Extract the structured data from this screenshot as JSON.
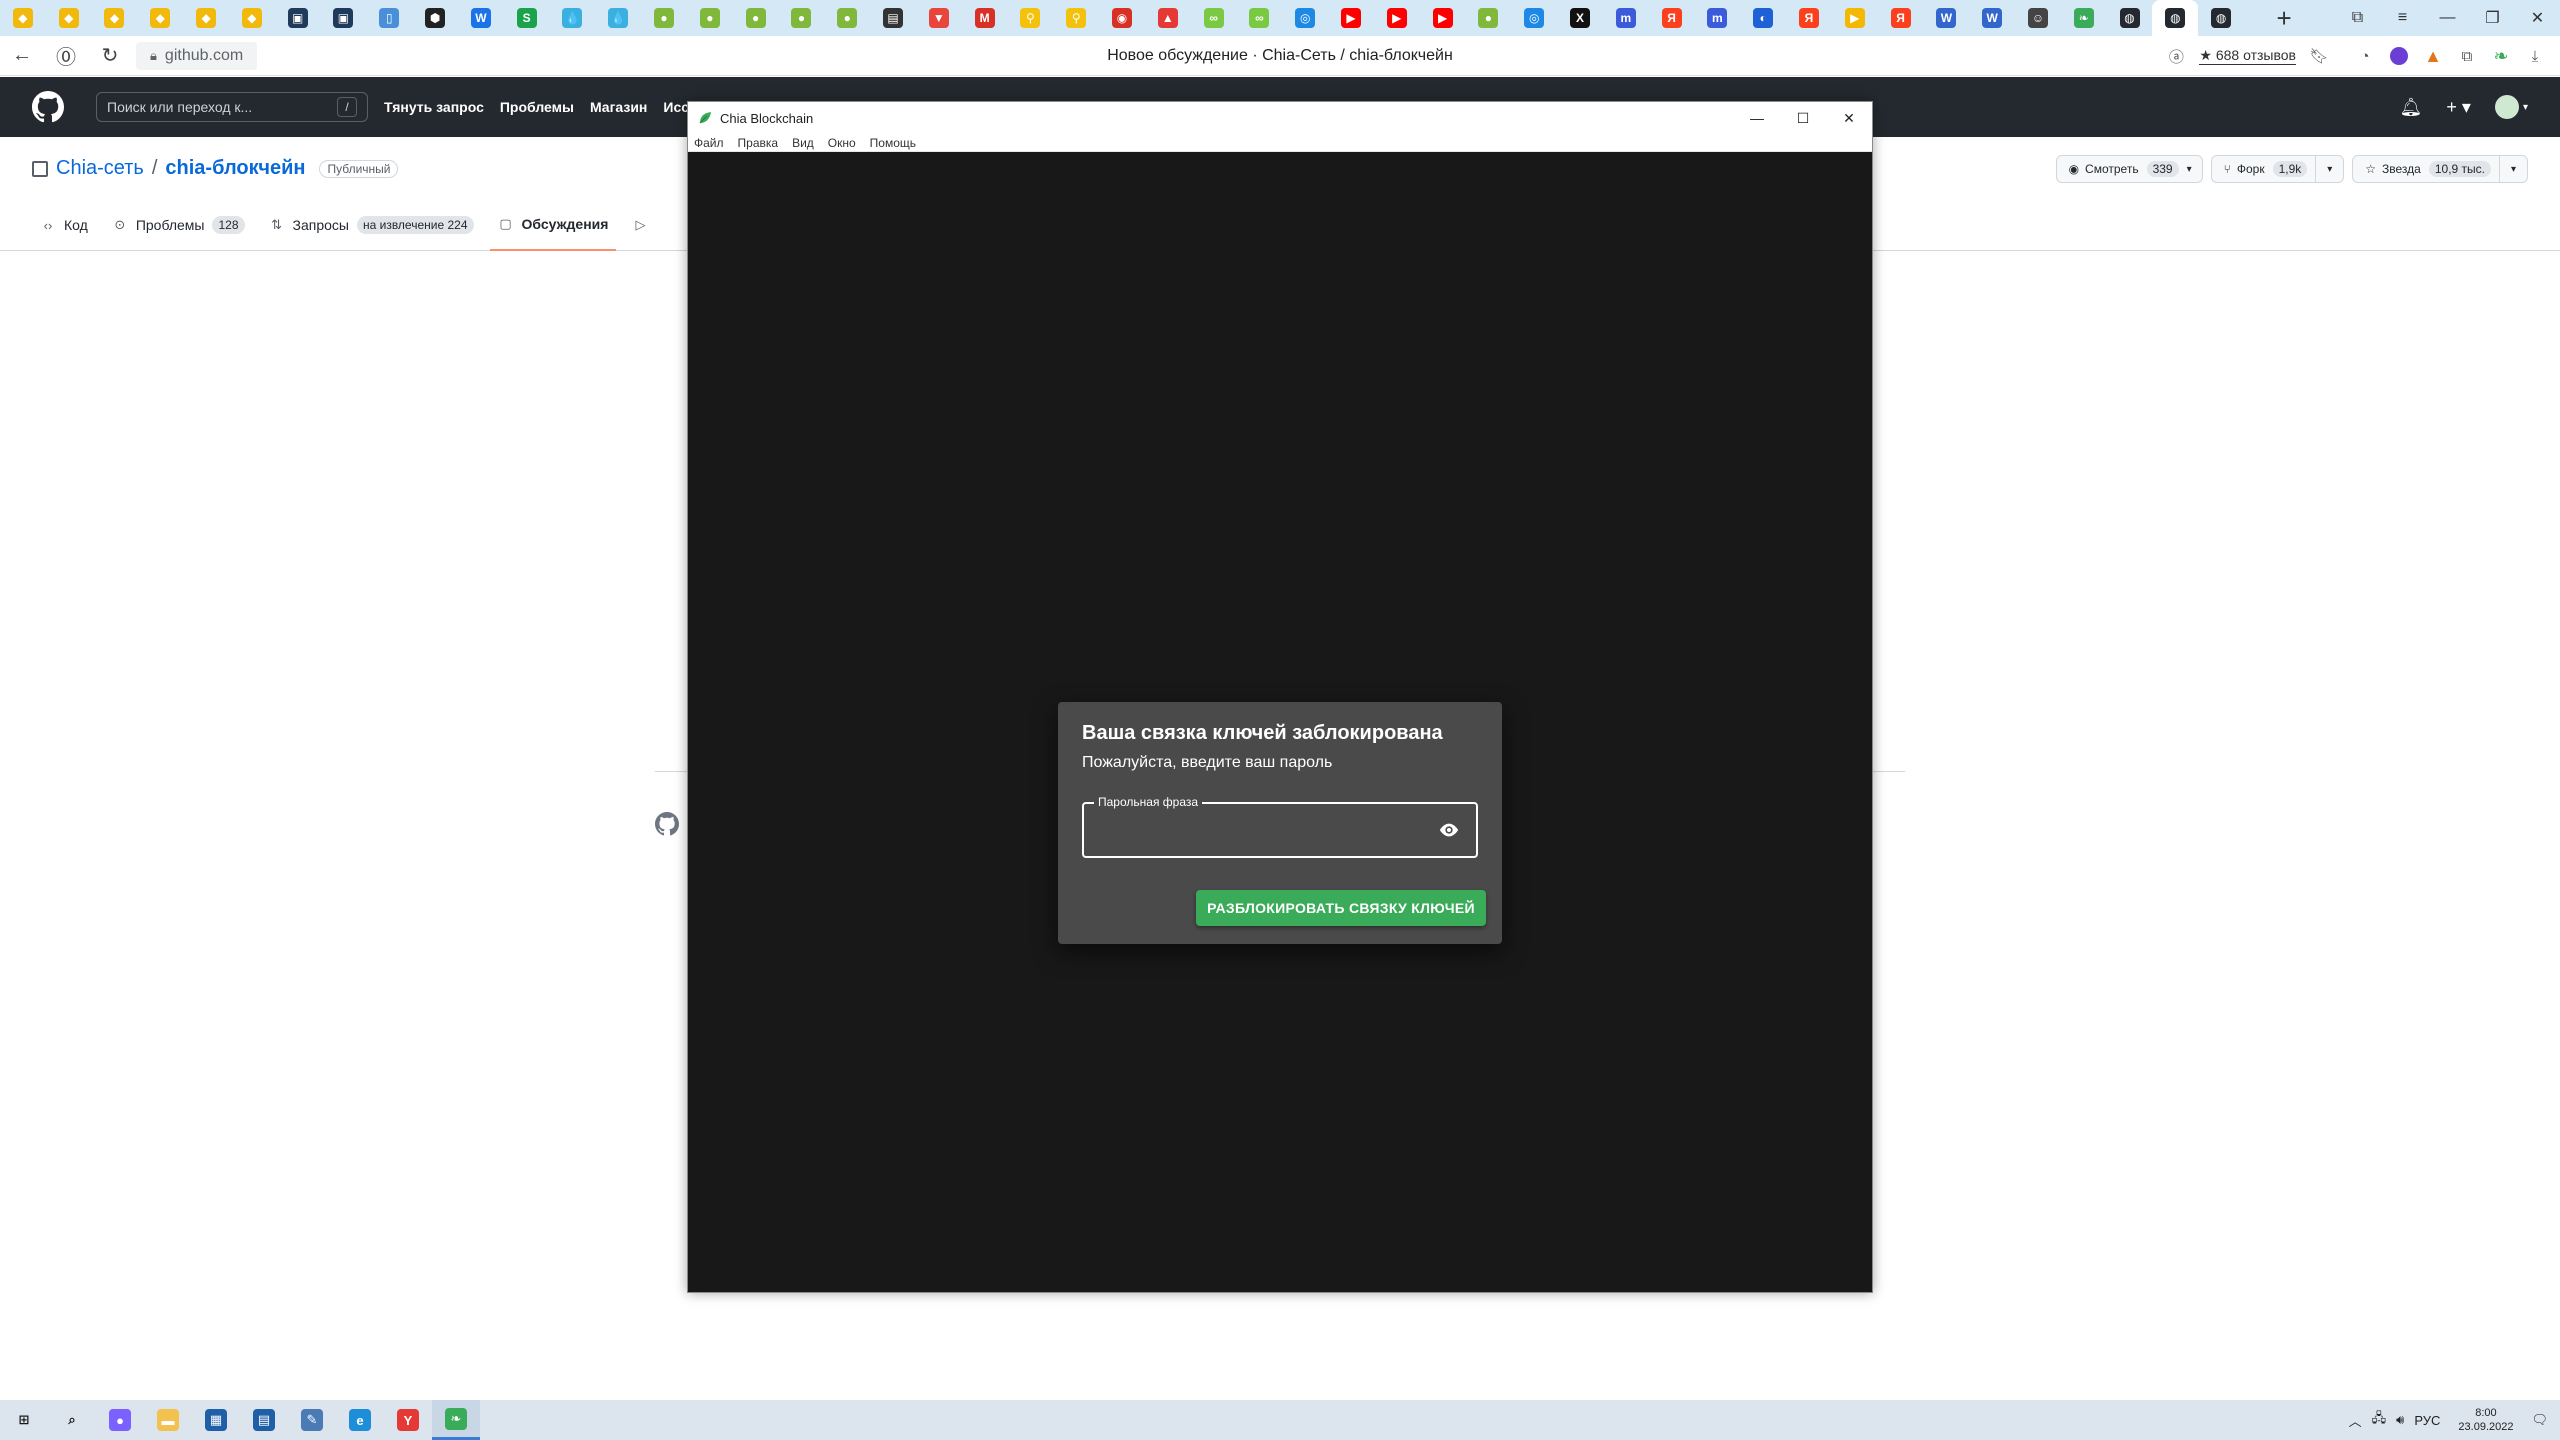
{
  "browser": {
    "tabs": [
      {
        "icon": "binance-icon",
        "color": "#f0b90b",
        "glyph": "◆"
      },
      {
        "icon": "binance-icon",
        "color": "#f0b90b",
        "glyph": "◆"
      },
      {
        "icon": "binance-icon",
        "color": "#f0b90b",
        "glyph": "◆"
      },
      {
        "icon": "binance-icon",
        "color": "#f0b90b",
        "glyph": "◆"
      },
      {
        "icon": "binance-icon",
        "color": "#f0b90b",
        "glyph": "◆"
      },
      {
        "icon": "binance-icon",
        "color": "#f0b90b",
        "glyph": "◆"
      },
      {
        "icon": "app-icon",
        "color": "#1f3a5a",
        "glyph": "▣"
      },
      {
        "icon": "app-icon",
        "color": "#1f3a5a",
        "glyph": "▣"
      },
      {
        "icon": "document-icon",
        "color": "#4a90d9",
        "glyph": "▯"
      },
      {
        "icon": "hive-icon",
        "color": "#222222",
        "glyph": "⬢"
      },
      {
        "icon": "w-icon",
        "color": "#1a73e8",
        "glyph": "W"
      },
      {
        "icon": "s-icon",
        "color": "#1aa34a",
        "glyph": "S"
      },
      {
        "icon": "drop-icon",
        "color": "#3ab0e0",
        "glyph": "💧"
      },
      {
        "icon": "drop-icon",
        "color": "#3ab0e0",
        "glyph": "💧"
      },
      {
        "icon": "chia-icon",
        "color": "#7fb83b",
        "glyph": "●"
      },
      {
        "icon": "chia-icon",
        "color": "#7fb83b",
        "glyph": "●"
      },
      {
        "icon": "chia-icon",
        "color": "#7fb83b",
        "glyph": "●"
      },
      {
        "icon": "chia-icon",
        "color": "#7fb83b",
        "glyph": "●"
      },
      {
        "icon": "chia-icon",
        "color": "#7fb83b",
        "glyph": "●"
      },
      {
        "icon": "chart-icon",
        "color": "#333333",
        "glyph": "▤"
      },
      {
        "icon": "flag-icon",
        "color": "#e8453c",
        "glyph": "▼"
      },
      {
        "icon": "gmail-icon",
        "color": "#d93025",
        "glyph": "M"
      },
      {
        "icon": "search-coin-icon",
        "color": "#f4c20d",
        "glyph": "⚲"
      },
      {
        "icon": "search-coin-icon",
        "color": "#f4c20d",
        "glyph": "⚲"
      },
      {
        "icon": "record-icon",
        "color": "#d93025",
        "glyph": "◉"
      },
      {
        "icon": "mushroom-icon",
        "color": "#e53935",
        "glyph": "▲"
      },
      {
        "icon": "link-icon",
        "color": "#7ac943",
        "glyph": "∞"
      },
      {
        "icon": "link-icon",
        "color": "#7ac943",
        "glyph": "∞"
      },
      {
        "icon": "browser-icon",
        "color": "#1e88e5",
        "glyph": "◎"
      },
      {
        "icon": "youtube-icon",
        "color": "#ff0000",
        "glyph": "▶"
      },
      {
        "icon": "youtube-icon",
        "color": "#ff0000",
        "glyph": "▶"
      },
      {
        "icon": "youtube-icon",
        "color": "#ff0000",
        "glyph": "▶"
      },
      {
        "icon": "chia-icon",
        "color": "#7fb83b",
        "glyph": "●"
      },
      {
        "icon": "browser-icon",
        "color": "#1e88e5",
        "glyph": "◎"
      },
      {
        "icon": "x-icon",
        "color": "#111111",
        "glyph": "X"
      },
      {
        "icon": "m-icon",
        "color": "#3b5bdb",
        "glyph": "m"
      },
      {
        "icon": "yandex-icon",
        "color": "#fc3f1d",
        "glyph": "Я"
      },
      {
        "icon": "m-icon",
        "color": "#3b5bdb",
        "glyph": "m"
      },
      {
        "icon": "chat-icon",
        "color": "#1e60d5",
        "glyph": "◐"
      },
      {
        "icon": "yandex-icon",
        "color": "#fc3f1d",
        "glyph": "Я"
      },
      {
        "icon": "play-icon",
        "color": "#f5b800",
        "glyph": "▶"
      },
      {
        "icon": "yandex-icon",
        "color": "#fc3f1d",
        "glyph": "Я"
      },
      {
        "icon": "wiki-icon",
        "color": "#3366cc",
        "glyph": "W"
      },
      {
        "icon": "wiki-icon",
        "color": "#3366cc",
        "glyph": "W"
      },
      {
        "icon": "emoji-icon",
        "color": "#444444",
        "glyph": "☺"
      },
      {
        "icon": "leaf-icon",
        "color": "#3aac59",
        "glyph": "❧"
      },
      {
        "icon": "github-icon",
        "color": "#24292f",
        "glyph": "◍"
      },
      {
        "icon": "github-icon",
        "color": "#24292f",
        "glyph": "◍",
        "active": true
      },
      {
        "icon": "github-icon",
        "color": "#24292f",
        "glyph": "◍"
      }
    ],
    "url": "github.com",
    "page_title": "Новое обсуждение · Chia-Сеть / chia-блокчейн",
    "reviews_label": "★ 688 отзывов"
  },
  "github": {
    "search_placeholder": "Поиск или переход к...",
    "search_shortcut": "/",
    "nav": [
      "Тянуть запрос",
      "Проблемы",
      "Магазин",
      "Исслед"
    ],
    "owner": "Chia-сеть",
    "separator": "/",
    "repo": "chia-блокчейн",
    "visibility": "Публичный",
    "watch": {
      "label": "Смотреть",
      "count": "339"
    },
    "fork": {
      "label": "Форк",
      "count": "1,9k"
    },
    "star": {
      "label": "Звезда",
      "count": "10,9 тыс."
    },
    "tabs": [
      {
        "icon": "code-icon",
        "glyph": "‹›",
        "label": "Код",
        "badge": ""
      },
      {
        "icon": "issue-icon",
        "glyph": "⊙",
        "label": "Проблемы",
        "badge": "128"
      },
      {
        "icon": "pull-request-icon",
        "glyph": "⇅",
        "label": "Запросы",
        "badge": "на извлечение 224"
      },
      {
        "icon": "discussion-icon",
        "glyph": "▢",
        "label": "Обсуждения",
        "badge": "",
        "selected": true
      },
      {
        "icon": "actions-icon",
        "glyph": "▷",
        "label": "",
        "badge": ""
      }
    ]
  },
  "chia": {
    "window_title": "Chia Blockchain",
    "menu": [
      "Файл",
      "Правка",
      "Вид",
      "Окно",
      "Помощь"
    ],
    "dialog": {
      "title": "Ваша связка ключей заблокирована",
      "subtitle": "Пожалуйста, введите ваш пароль",
      "field_label": "Парольная фраза",
      "field_value": "",
      "button": "РАЗБЛОКИРОВАТЬ СВЯЗКУ КЛЮЧЕЙ"
    },
    "accent": "#3aac59"
  },
  "taskbar": {
    "language": "РУС",
    "time": "8:00",
    "date": "23.09.2022",
    "apps": [
      {
        "icon": "windows-start-icon",
        "color": "#1a1a1a",
        "glyph": "⊞"
      },
      {
        "icon": "search-icon",
        "color": "#1a1a1a",
        "glyph": "⌕"
      },
      {
        "icon": "alice-icon",
        "color": "#7b61ff",
        "glyph": "●"
      },
      {
        "icon": "file-explorer-icon",
        "color": "#f2c14e",
        "glyph": "▬"
      },
      {
        "icon": "calculator-icon",
        "color": "#1f5fa8",
        "glyph": "▦"
      },
      {
        "icon": "terminal-icon",
        "color": "#1f5fa8",
        "glyph": "▤"
      },
      {
        "icon": "feather-icon",
        "color": "#4a7bb5",
        "glyph": "✎"
      },
      {
        "icon": "edge-icon",
        "color": "#1d8fd8",
        "glyph": "e"
      },
      {
        "icon": "yandex-browser-icon",
        "color": "#e53935",
        "glyph": "Y"
      },
      {
        "icon": "chia-app-icon",
        "color": "#3aac59",
        "glyph": "❧",
        "active": true
      }
    ]
  }
}
